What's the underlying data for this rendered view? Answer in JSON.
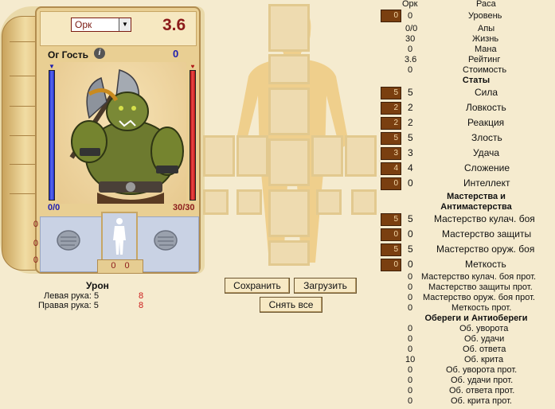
{
  "card": {
    "race_value": "Орк",
    "rating": "3.6",
    "nickname": "Ог Гость",
    "level": "0",
    "hp": "0/0",
    "mana": "30/30",
    "side_counts": [
      "0",
      "0",
      "0"
    ],
    "bottom_counts": "0 0"
  },
  "damage": {
    "title": "Урон",
    "left_label": "Левая рука: 5",
    "left_value": "8",
    "right_label": "Правая рука: 5",
    "right_value": "8"
  },
  "buttons": {
    "save": "Сохранить",
    "load": "Загрузить",
    "remove_all": "Снять все"
  },
  "header": {
    "race_col": "Орк",
    "race_label": "Раса"
  },
  "level_row": {
    "box": "0",
    "value": "0",
    "label": "Уровень"
  },
  "base": [
    {
      "value": "0/0",
      "label": "Апы"
    },
    {
      "value": "30",
      "label": "Жизнь"
    },
    {
      "value": "0",
      "label": "Мана"
    },
    {
      "value": "3.6",
      "label": "Рейтинг"
    },
    {
      "value": "0",
      "label": "Стоимость"
    }
  ],
  "stats_title": "Статы",
  "stats": [
    {
      "box": "5",
      "value": "5",
      "label": "Сила"
    },
    {
      "box": "2",
      "value": "2",
      "label": "Ловкость"
    },
    {
      "box": "2",
      "value": "2",
      "label": "Реакция"
    },
    {
      "box": "5",
      "value": "5",
      "label": "Злость"
    },
    {
      "box": "3",
      "value": "3",
      "label": "Удача"
    },
    {
      "box": "4",
      "value": "4",
      "label": "Сложение"
    },
    {
      "box": "0",
      "value": "0",
      "label": "Интеллект"
    }
  ],
  "mastery_title_1": "Мастерства и",
  "mastery_title_2": "Антимастерства",
  "mastery": [
    {
      "box": "5",
      "value": "5",
      "label": "Мастерство кулач. боя"
    },
    {
      "box": "0",
      "value": "0",
      "label": "Мастерство защиты"
    },
    {
      "box": "5",
      "value": "5",
      "label": "Мастерство оруж. боя"
    },
    {
      "box": "0",
      "value": "0",
      "label": "Меткость"
    }
  ],
  "antimastery": [
    {
      "value": "0",
      "label": "Мастерство кулач. боя прот."
    },
    {
      "value": "0",
      "label": "Мастерство защиты прот."
    },
    {
      "value": "0",
      "label": "Мастерство оруж. боя прот."
    },
    {
      "value": "0",
      "label": "Меткость прот."
    }
  ],
  "charms_title": "Обереги и Антиобереги",
  "charms": [
    {
      "value": "0",
      "label": "Об. уворота"
    },
    {
      "value": "0",
      "label": "Об. удачи"
    },
    {
      "value": "0",
      "label": "Об. ответа"
    },
    {
      "value": "10",
      "label": "Об. крита"
    },
    {
      "value": "0",
      "label": "Об. уворота прот."
    },
    {
      "value": "0",
      "label": "Об. удачи прот."
    },
    {
      "value": "0",
      "label": "Об. ответа прот."
    },
    {
      "value": "0",
      "label": "Об. крита прот."
    }
  ],
  "colors": {
    "stat_box": "#7a3f10",
    "accent_red": "#8b1a1a",
    "hp_blue": "#1f2bc7",
    "background": "#f5ebcf"
  }
}
